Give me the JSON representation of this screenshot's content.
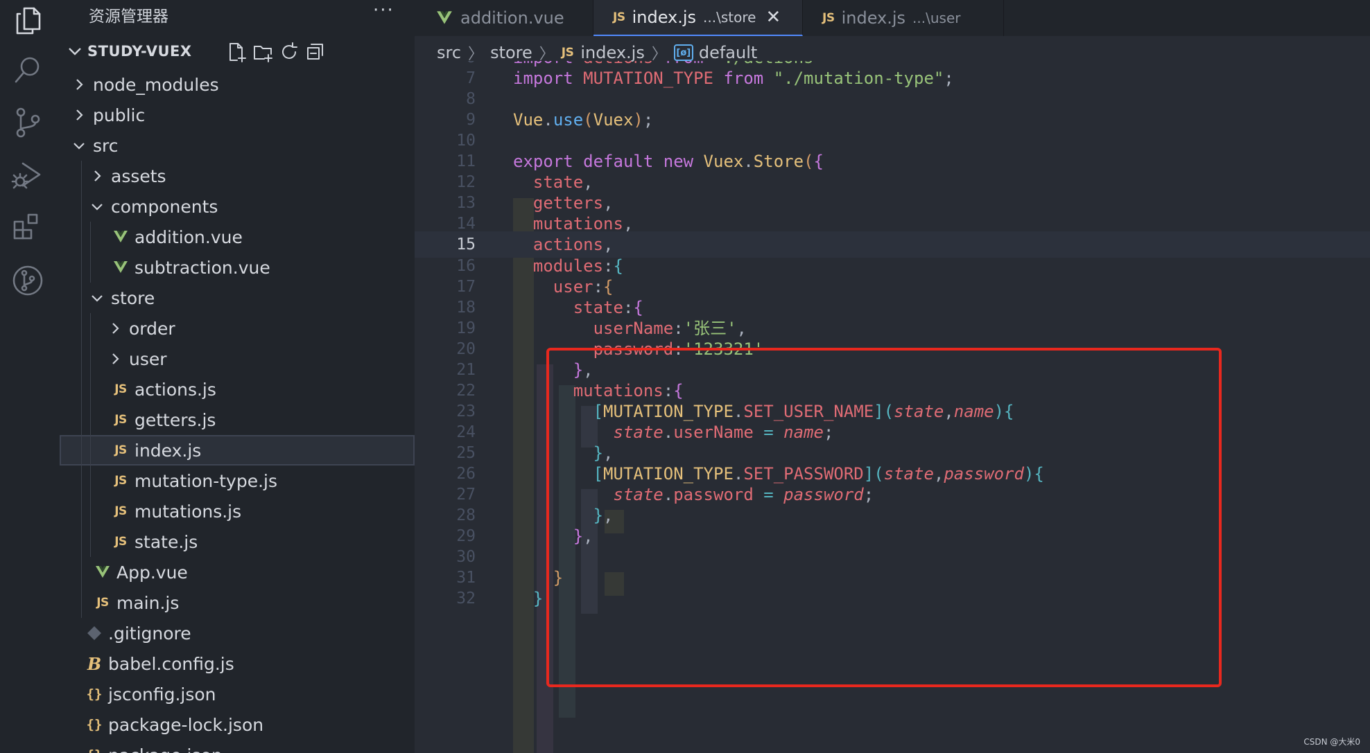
{
  "activity_bar": {
    "icons": [
      "explorer-icon",
      "search-icon",
      "source-control-icon",
      "run-debug-icon",
      "extensions-icon",
      "git-graph-icon"
    ]
  },
  "sidebar": {
    "title": "资源管理器",
    "more": "···",
    "project": "STUDY-VUEX",
    "tree": [
      {
        "label": "node_modules",
        "type": "folder",
        "expanded": false,
        "depth": 0
      },
      {
        "label": "public",
        "type": "folder",
        "expanded": false,
        "depth": 0
      },
      {
        "label": "src",
        "type": "folder",
        "expanded": true,
        "depth": 0
      },
      {
        "label": "assets",
        "type": "folder",
        "expanded": false,
        "depth": 1
      },
      {
        "label": "components",
        "type": "folder",
        "expanded": true,
        "depth": 1
      },
      {
        "label": "addition.vue",
        "type": "vue",
        "depth": 2
      },
      {
        "label": "subtraction.vue",
        "type": "vue",
        "depth": 2
      },
      {
        "label": "store",
        "type": "folder",
        "expanded": true,
        "depth": 1
      },
      {
        "label": "order",
        "type": "folder",
        "expanded": false,
        "depth": 2
      },
      {
        "label": "user",
        "type": "folder",
        "expanded": false,
        "depth": 2
      },
      {
        "label": "actions.js",
        "type": "js",
        "depth": 2
      },
      {
        "label": "getters.js",
        "type": "js",
        "depth": 2
      },
      {
        "label": "index.js",
        "type": "js",
        "depth": 2,
        "selected": true
      },
      {
        "label": "mutation-type.js",
        "type": "js",
        "depth": 2
      },
      {
        "label": "mutations.js",
        "type": "js",
        "depth": 2
      },
      {
        "label": "state.js",
        "type": "js",
        "depth": 2
      },
      {
        "label": "App.vue",
        "type": "vue",
        "depth": 1
      },
      {
        "label": "main.js",
        "type": "js",
        "depth": 1
      },
      {
        "label": ".gitignore",
        "type": "git",
        "depth": 0
      },
      {
        "label": "babel.config.js",
        "type": "babel",
        "depth": 0
      },
      {
        "label": "jsconfig.json",
        "type": "json",
        "depth": 0
      },
      {
        "label": "package-lock.json",
        "type": "json",
        "depth": 0
      },
      {
        "label": "package.json",
        "type": "json",
        "depth": 0
      }
    ]
  },
  "tabs": [
    {
      "label": "addition.vue",
      "icon": "vue",
      "desc": "",
      "active": false
    },
    {
      "label": "index.js",
      "icon": "js",
      "desc": "...\\store",
      "active": true,
      "close": "✕"
    },
    {
      "label": "index.js",
      "icon": "js",
      "desc": "...\\user",
      "active": false
    }
  ],
  "breadcrumb": {
    "parts": [
      "src",
      "store",
      "index.js",
      "default"
    ],
    "file_icon": "JS",
    "symbol_icon": "[ø]"
  },
  "icons": {
    "js": "JS",
    "vue": "V",
    "json": "{}",
    "babel": "B"
  },
  "editor": {
    "current_line": 15,
    "lines": [
      {
        "n": "6",
        "t": [
          [
            "kw",
            "import "
          ],
          [
            "var",
            "actions "
          ],
          [
            "kw",
            "from "
          ],
          [
            "str",
            "\"./actions\""
          ]
        ]
      },
      {
        "n": "7",
        "t": [
          [
            "kw",
            "import "
          ],
          [
            "var",
            "MUTATION_TYPE "
          ],
          [
            "kw",
            "from "
          ],
          [
            "str",
            "\"./mutation-type\""
          ],
          [
            "pn",
            ";"
          ]
        ]
      },
      {
        "n": "8",
        "t": []
      },
      {
        "n": "9",
        "t": [
          [
            "cls",
            "Vue"
          ],
          [
            "pn",
            "."
          ],
          [
            "fn",
            "use"
          ],
          [
            "br1",
            "("
          ],
          [
            "cls",
            "Vuex"
          ],
          [
            "br1",
            ")"
          ],
          [
            "pn",
            ";"
          ]
        ]
      },
      {
        "n": "10",
        "t": []
      },
      {
        "n": "11",
        "t": [
          [
            "kw",
            "export default new "
          ],
          [
            "cls",
            "Vuex"
          ],
          [
            "pn",
            "."
          ],
          [
            "cls",
            "Store"
          ],
          [
            "br1",
            "("
          ],
          [
            "br2",
            "{"
          ]
        ]
      },
      {
        "n": "12",
        "t": [
          [
            "pn",
            "  "
          ],
          [
            "var",
            "state"
          ],
          [
            "pn",
            ","
          ]
        ]
      },
      {
        "n": "13",
        "t": [
          [
            "pn",
            "  "
          ],
          [
            "var",
            "getters"
          ],
          [
            "pn",
            ","
          ]
        ]
      },
      {
        "n": "14",
        "t": [
          [
            "pn",
            "  "
          ],
          [
            "var",
            "mutations"
          ],
          [
            "pn",
            ","
          ]
        ]
      },
      {
        "n": "15",
        "t": [
          [
            "pn",
            "  "
          ],
          [
            "var",
            "actions"
          ],
          [
            "pn",
            ","
          ]
        ]
      },
      {
        "n": "16",
        "t": [
          [
            "pn",
            "  "
          ],
          [
            "var",
            "modules"
          ],
          [
            "pn",
            ":"
          ],
          [
            "br3",
            "{"
          ]
        ]
      },
      {
        "n": "17",
        "t": [
          [
            "pn",
            "    "
          ],
          [
            "var",
            "user"
          ],
          [
            "pn",
            ":"
          ],
          [
            "br1",
            "{"
          ]
        ]
      },
      {
        "n": "18",
        "t": [
          [
            "pn",
            "      "
          ],
          [
            "var",
            "state"
          ],
          [
            "pn",
            ":"
          ],
          [
            "br2",
            "{"
          ]
        ]
      },
      {
        "n": "19",
        "t": [
          [
            "pn",
            "        "
          ],
          [
            "var",
            "userName"
          ],
          [
            "pn",
            ":"
          ],
          [
            "str",
            "'张三'"
          ],
          [
            "pn",
            ","
          ]
        ]
      },
      {
        "n": "20",
        "t": [
          [
            "pn",
            "        "
          ],
          [
            "var",
            "password"
          ],
          [
            "pn",
            ":"
          ],
          [
            "str",
            "'123321'"
          ]
        ]
      },
      {
        "n": "21",
        "t": [
          [
            "pn",
            "      "
          ],
          [
            "br2",
            "}"
          ],
          [
            "pn",
            ","
          ]
        ]
      },
      {
        "n": "22",
        "t": [
          [
            "pn",
            "      "
          ],
          [
            "var",
            "mutations"
          ],
          [
            "pn",
            ":"
          ],
          [
            "br2",
            "{"
          ]
        ]
      },
      {
        "n": "23",
        "t": [
          [
            "pn",
            "        "
          ],
          [
            "br3",
            "["
          ],
          [
            "cls",
            "MUTATION_TYPE"
          ],
          [
            "pn",
            "."
          ],
          [
            "var",
            "SET_USER_NAME"
          ],
          [
            "br3",
            "]"
          ],
          [
            "br3",
            "("
          ],
          [
            "prm",
            "state"
          ],
          [
            "pn",
            ","
          ],
          [
            "prm",
            "name"
          ],
          [
            "br3",
            ")"
          ],
          [
            "br3",
            "{"
          ]
        ]
      },
      {
        "n": "24",
        "t": [
          [
            "pn",
            "          "
          ],
          [
            "prm",
            "state"
          ],
          [
            "pn",
            "."
          ],
          [
            "var",
            "userName"
          ],
          [
            "pn",
            " "
          ],
          [
            "op",
            "="
          ],
          [
            "pn",
            " "
          ],
          [
            "prm",
            "name"
          ],
          [
            "pn",
            ";"
          ]
        ]
      },
      {
        "n": "25",
        "t": [
          [
            "pn",
            "        "
          ],
          [
            "br3",
            "}"
          ],
          [
            "pn",
            ","
          ]
        ]
      },
      {
        "n": "26",
        "t": [
          [
            "pn",
            "        "
          ],
          [
            "br3",
            "["
          ],
          [
            "cls",
            "MUTATION_TYPE"
          ],
          [
            "pn",
            "."
          ],
          [
            "var",
            "SET_PASSWORD"
          ],
          [
            "br3",
            "]"
          ],
          [
            "br3",
            "("
          ],
          [
            "prm",
            "state"
          ],
          [
            "pn",
            ","
          ],
          [
            "prm",
            "password"
          ],
          [
            "br3",
            ")"
          ],
          [
            "br3",
            "{"
          ]
        ]
      },
      {
        "n": "27",
        "t": [
          [
            "pn",
            "          "
          ],
          [
            "prm",
            "state"
          ],
          [
            "pn",
            "."
          ],
          [
            "var",
            "password"
          ],
          [
            "pn",
            " "
          ],
          [
            "op",
            "="
          ],
          [
            "pn",
            " "
          ],
          [
            "prm",
            "password"
          ],
          [
            "pn",
            ";"
          ]
        ]
      },
      {
        "n": "28",
        "t": [
          [
            "pn",
            "        "
          ],
          [
            "br3",
            "}"
          ],
          [
            "pn",
            ","
          ]
        ]
      },
      {
        "n": "29",
        "t": [
          [
            "pn",
            "      "
          ],
          [
            "br2",
            "}"
          ],
          [
            "pn",
            ","
          ]
        ]
      },
      {
        "n": "30",
        "t": []
      },
      {
        "n": "31",
        "t": [
          [
            "pn",
            "    "
          ],
          [
            "br1",
            "}"
          ]
        ]
      },
      {
        "n": "32",
        "t": [
          [
            "pn",
            "  "
          ],
          [
            "br3",
            "}"
          ]
        ]
      }
    ]
  },
  "watermark": "CSDN @大米0"
}
